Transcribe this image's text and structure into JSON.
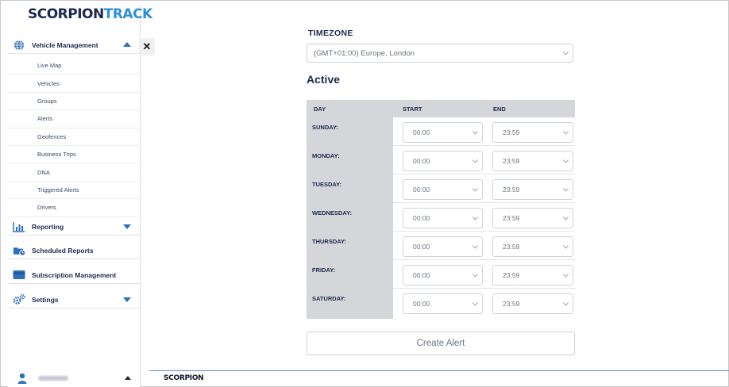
{
  "brand": {
    "logo_part1": "SCORPION",
    "logo_part2": "TRACK",
    "footer_logo": "SCORPION"
  },
  "sidebar": {
    "vehicle_management": "Vehicle Management",
    "vehicle_items": [
      "Live Map",
      "Vehicles",
      "Groups",
      "Alerts",
      "Geofences",
      "Business Trips",
      "DNA",
      "Triggered Alerts",
      "Drivers"
    ],
    "reporting": "Reporting",
    "scheduled_reports": "Scheduled Reports",
    "subscription_management": "Subscription Management",
    "settings": "Settings",
    "close_symbol": "✕"
  },
  "form": {
    "timezone_label": "TIMEZONE",
    "timezone_value": "(GMT+01:00) Europe, London",
    "active_title": "Active",
    "columns": {
      "day": "DAY",
      "start": "START",
      "end": "END"
    },
    "days": [
      {
        "day": "SUNDAY:",
        "start": "00:00",
        "end": "23:59"
      },
      {
        "day": "MONDAY:",
        "start": "00:00",
        "end": "23:59"
      },
      {
        "day": "TUESDAY:",
        "start": "00:00",
        "end": "23:59"
      },
      {
        "day": "WEDNESDAY:",
        "start": "00:00",
        "end": "23:59"
      },
      {
        "day": "THURSDAY:",
        "start": "00:00",
        "end": "23:59"
      },
      {
        "day": "FRIDAY:",
        "start": "00:00",
        "end": "23:59"
      },
      {
        "day": "SATURDAY:",
        "start": "00:00",
        "end": "23:59"
      }
    ],
    "create_button": "Create Alert"
  },
  "colors": {
    "brand_dark": "#1b2a4e",
    "brand_blue": "#2e8fd8",
    "accent": "#2e6fba",
    "table_header": "#d4d6da"
  }
}
